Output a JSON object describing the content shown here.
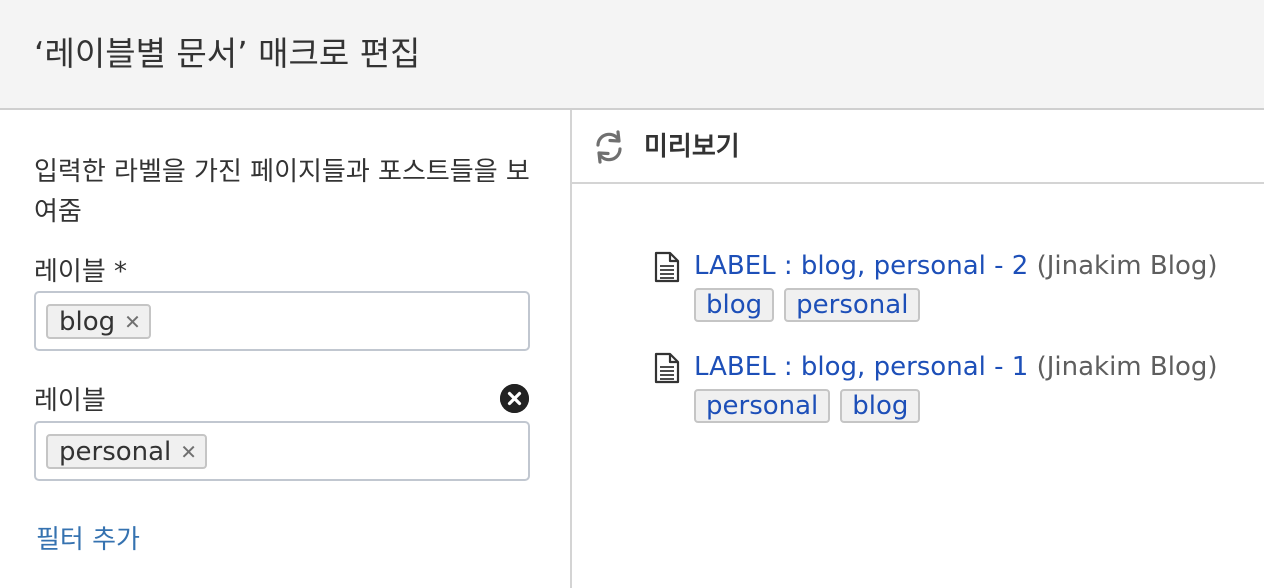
{
  "dialog": {
    "title": "‘레이블별 문서’ 매크로 편집"
  },
  "left_panel": {
    "description": "입력한 라벨을 가진 페이지들과 포스트들을 보여줌",
    "filters": [
      {
        "label": "레이블 *",
        "chips": [
          "blog"
        ],
        "remove_icon": "close-circle-icon"
      },
      {
        "label": "레이블",
        "chips": [
          "personal"
        ],
        "remove_icon": "close-circle-icon"
      }
    ],
    "add_filter_label": "필터 추가"
  },
  "preview": {
    "title": "미리보기",
    "refresh_icon": "refresh-icon",
    "results": [
      {
        "title": "LABEL : blog, personal - 2",
        "space": "(Jinakim Blog)",
        "icon": "page-icon",
        "tags": [
          "blog",
          "personal"
        ]
      },
      {
        "title": "LABEL : blog, personal - 1",
        "space": "(Jinakim Blog)",
        "icon": "page-icon",
        "tags": [
          "personal",
          "blog"
        ]
      }
    ]
  },
  "colors": {
    "header_bg": "#f4f4f4",
    "link": "#1d4fb8",
    "add_filter_link": "#3572b0",
    "chip_bg": "#f0f0f0"
  }
}
